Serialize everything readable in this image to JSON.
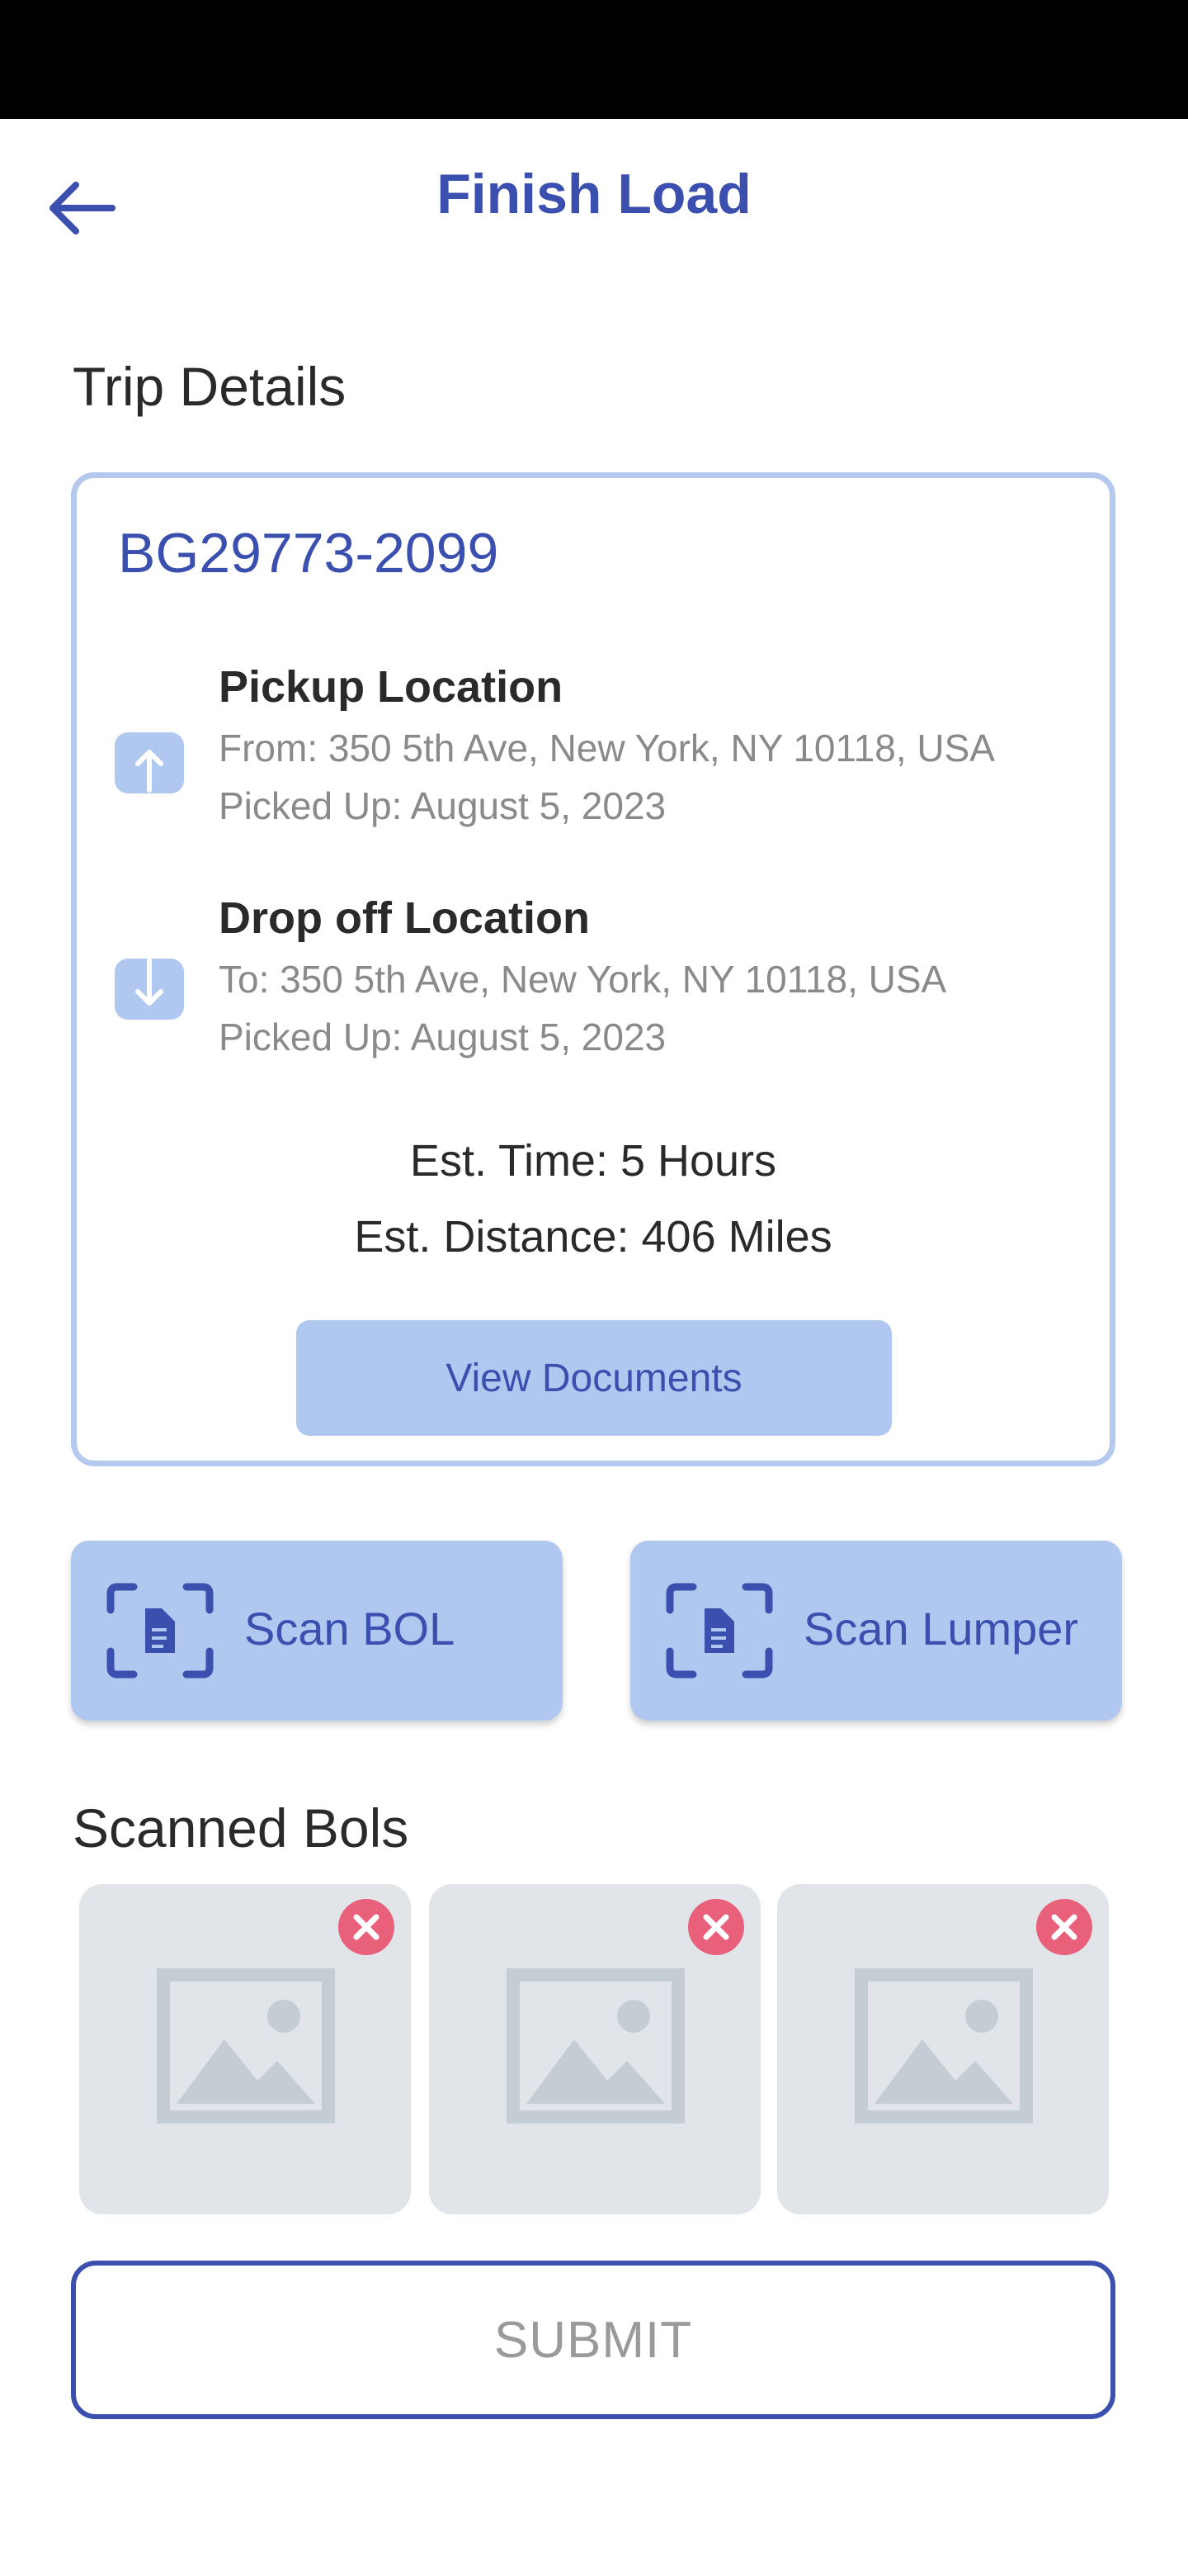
{
  "header": {
    "title": "Finish Load",
    "back_icon": "arrow-left-icon"
  },
  "trip_details": {
    "heading": "Trip Details",
    "trip_id": "BG29773-2099",
    "pickup": {
      "title": "Pickup Location",
      "address": "From: 350 5th Ave, New York, NY 10118, USA",
      "date": "Picked Up: August 5, 2023",
      "icon": "upload-arrow-icon"
    },
    "dropoff": {
      "title": "Drop off Location",
      "address": "To: 350 5th Ave, New York, NY 10118, USA",
      "date": "Picked Up: August 5, 2023",
      "icon": "download-arrow-icon"
    },
    "est_time": "Est. Time: 5 Hours",
    "est_distance": "Est. Distance: 406 Miles",
    "view_documents_label": "View Documents"
  },
  "scan": {
    "bol_label": "Scan BOL",
    "lumper_label": "Scan Lumper",
    "icon": "document-scan-icon"
  },
  "scanned_bols": {
    "heading": "Scanned Bols",
    "items": [
      {
        "icon": "image-placeholder-icon",
        "remove_icon": "remove-x-icon"
      },
      {
        "icon": "image-placeholder-icon",
        "remove_icon": "remove-x-icon"
      },
      {
        "icon": "image-placeholder-icon",
        "remove_icon": "remove-x-icon"
      }
    ]
  },
  "submit_label": "SUBMIT",
  "colors": {
    "primary": "#3a4fae",
    "accent_light": "#b0c8ef",
    "card_border": "#b5c9ee",
    "remove_red": "#e8607a",
    "placeholder_bg": "#e1e5ea"
  }
}
